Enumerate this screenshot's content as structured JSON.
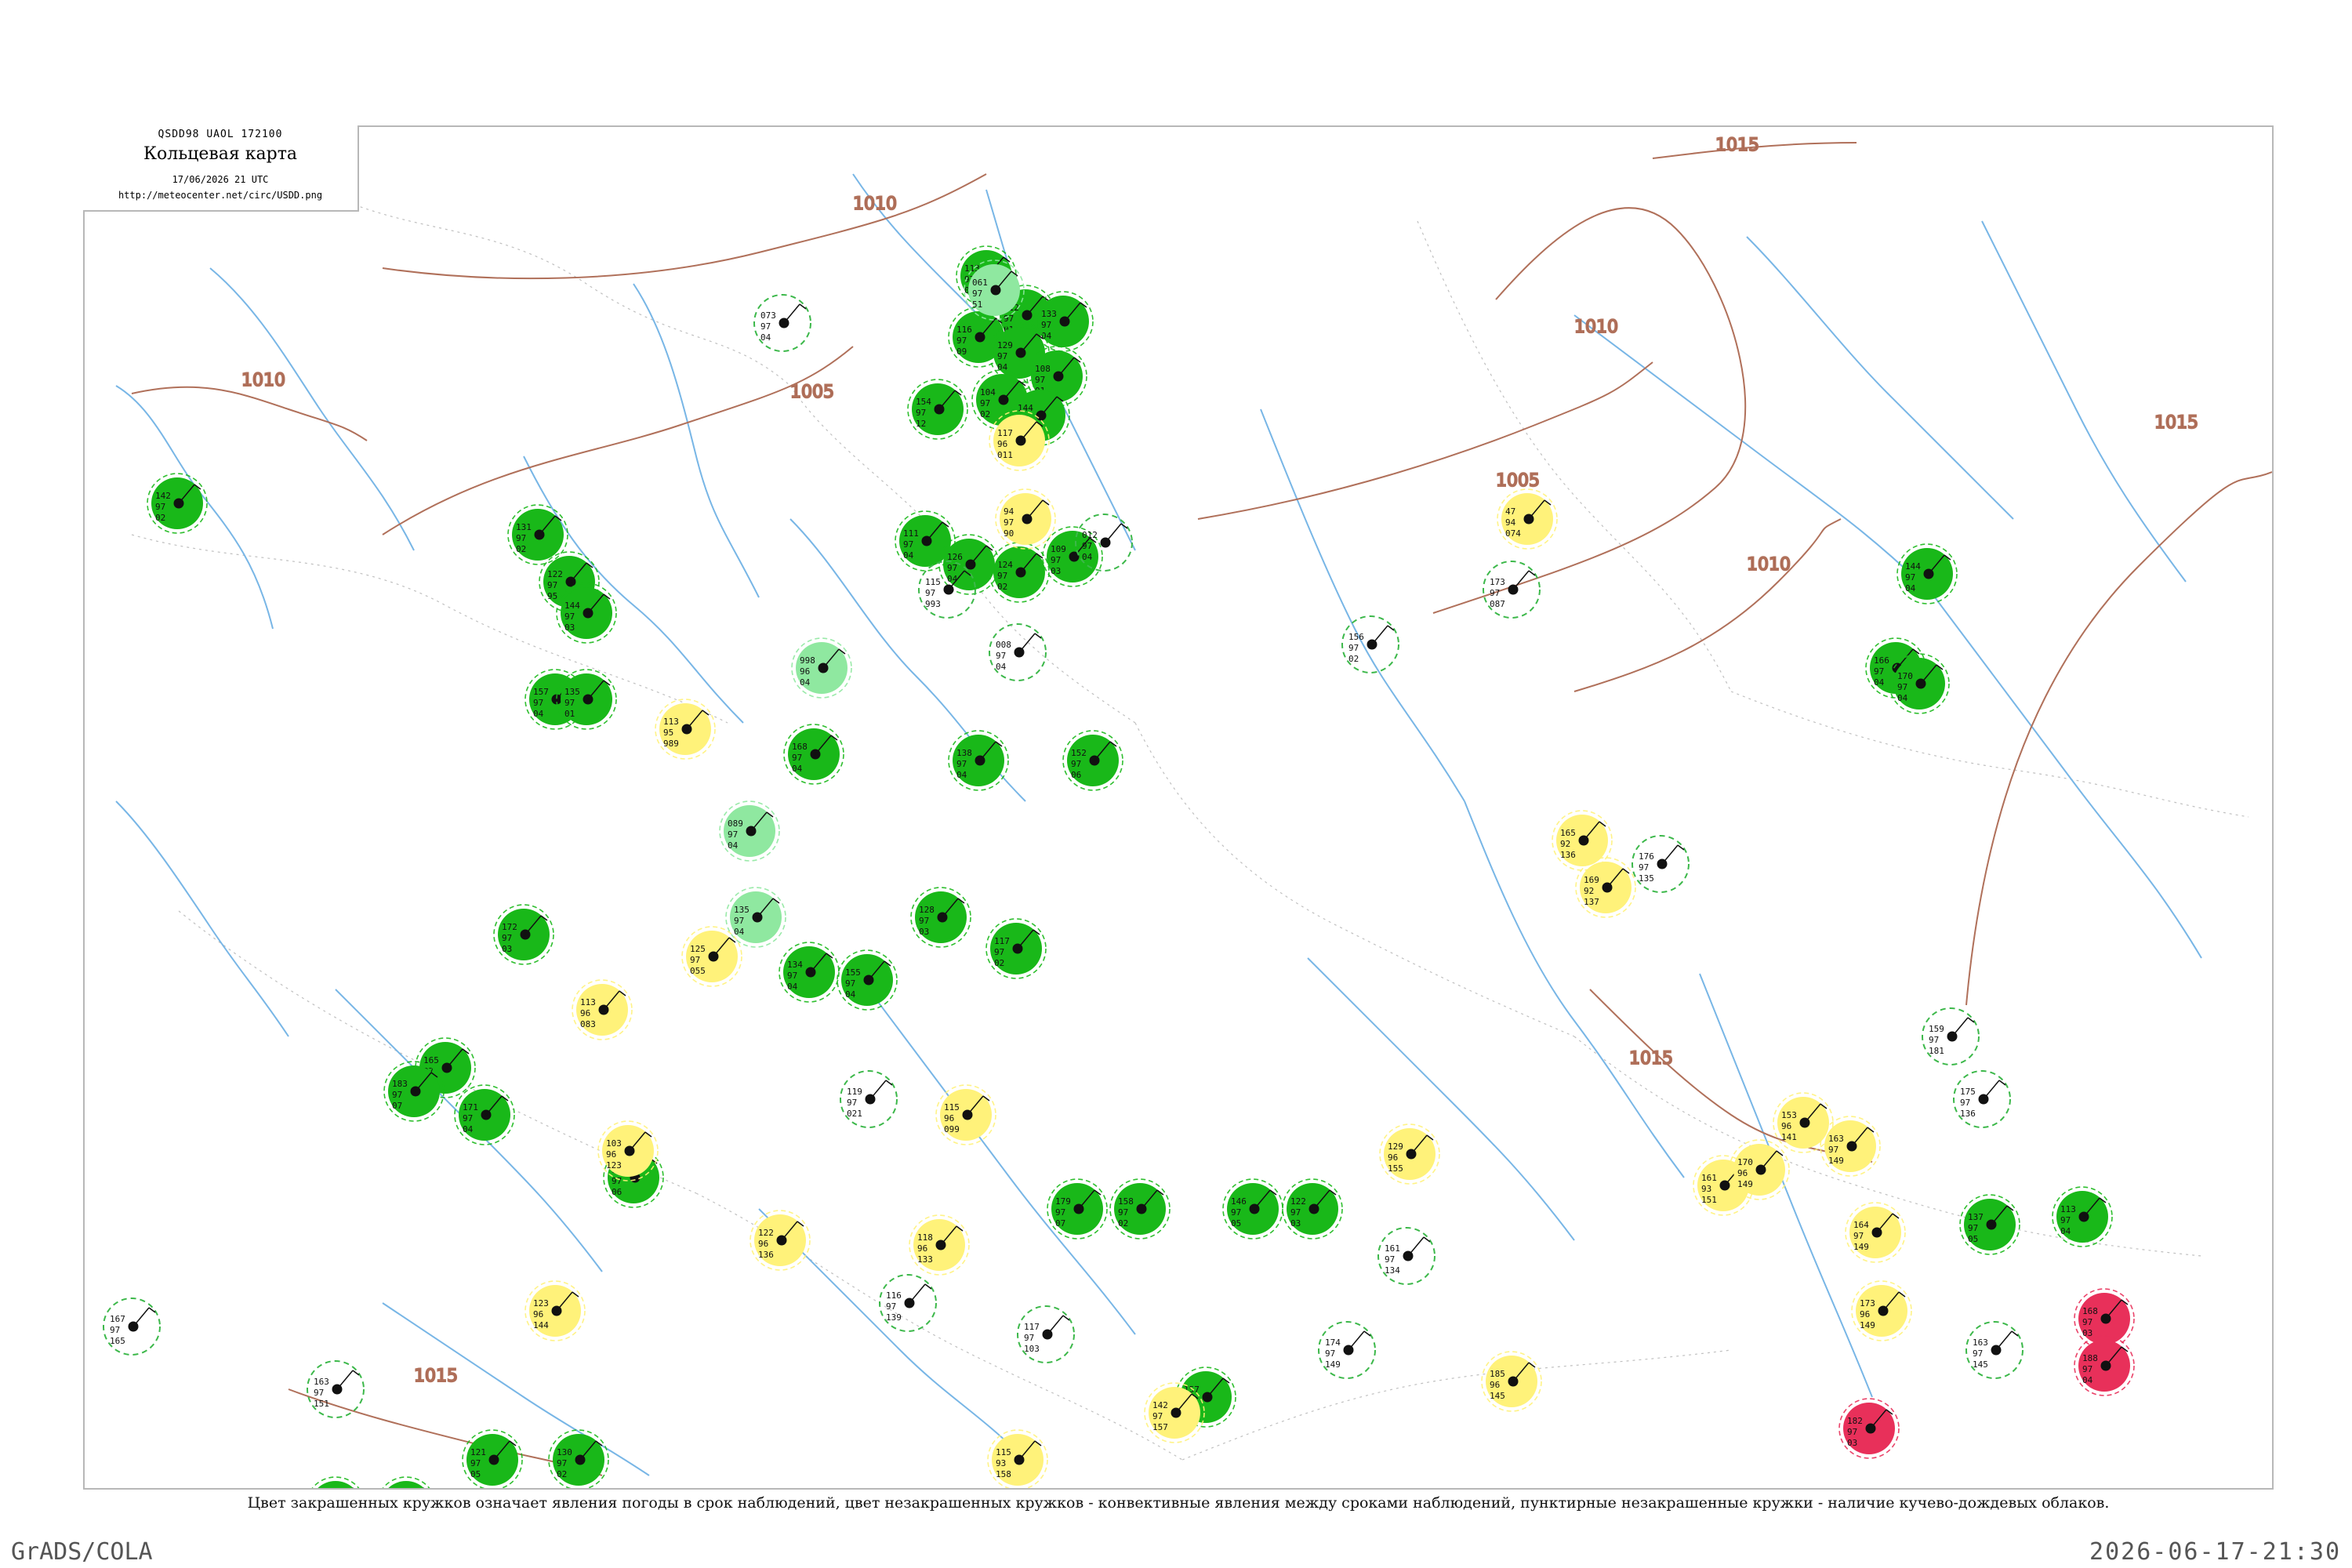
{
  "header": {
    "code": "QSDD98  UAOL  172100",
    "title": "Кольцевая карта",
    "date": "17/06/2026 21 UTC",
    "url": "http://meteocenter.net/circ/USDD.png"
  },
  "caption": "Цвет закрашенных кружков означает явления погоды в срок наблюдений, цвет незакрашенных кружков - конвективные явления между сроками наблюдений, пунктирные незакрашенные кружки - наличие кучево-дождевых облаков.",
  "footer": {
    "left": "GrADS/COLA",
    "right": "2026-06-17-21:30"
  },
  "colors": {
    "rain": "#19b819",
    "shower": "#8fe8a0",
    "fog": "#fff27a",
    "thunder": "#e8305a",
    "isobar": "#b0705a",
    "river": "#78b6e6",
    "border": "#c0c0c0"
  },
  "isobars": [
    {
      "label": "1010"
    },
    {
      "label": "1005"
    },
    {
      "label": "1010"
    },
    {
      "label": "1005"
    },
    {
      "label": "1010"
    },
    {
      "label": "1015"
    },
    {
      "label": "1010"
    },
    {
      "label": "1015"
    },
    {
      "label": "1015"
    },
    {
      "label": "1015"
    }
  ],
  "stations": [
    {
      "kind": "rain",
      "values": [
        "142",
        "97",
        "02"
      ]
    },
    {
      "kind": "rain",
      "values": [
        "131",
        "97",
        "02"
      ]
    },
    {
      "kind": "rain",
      "values": [
        "122",
        "97",
        "95"
      ]
    },
    {
      "kind": "rain",
      "values": [
        "144",
        "97",
        "03"
      ]
    },
    {
      "kind": "rain",
      "values": [
        "113",
        "97",
        "02"
      ]
    },
    {
      "kind": "rain",
      "values": [
        "112",
        "97",
        "01"
      ]
    },
    {
      "kind": "rain",
      "values": [
        "133",
        "97",
        "04"
      ]
    },
    {
      "kind": "rain",
      "values": [
        "116",
        "97",
        "09"
      ]
    },
    {
      "kind": "rain",
      "values": [
        "129",
        "97",
        "04"
      ]
    },
    {
      "kind": "rain",
      "values": [
        "108",
        "97",
        "01"
      ]
    },
    {
      "kind": "rain",
      "values": [
        "104",
        "97",
        "02"
      ]
    },
    {
      "kind": "rain",
      "values": [
        "144",
        "97",
        "03"
      ]
    },
    {
      "kind": "rain",
      "values": [
        "154",
        "97",
        "12"
      ]
    },
    {
      "kind": "rain",
      "values": [
        "109",
        "97",
        "03"
      ]
    },
    {
      "kind": "rain",
      "values": [
        "124",
        "97",
        "02"
      ]
    },
    {
      "kind": "rain",
      "values": [
        "111",
        "97",
        "04"
      ]
    },
    {
      "kind": "rain",
      "values": [
        "126",
        "97",
        "04"
      ]
    },
    {
      "kind": "rain",
      "values": [
        "157",
        "97",
        "04"
      ]
    },
    {
      "kind": "rain",
      "values": [
        "135",
        "97",
        "01"
      ]
    },
    {
      "kind": "rain",
      "values": [
        "152",
        "97",
        "06"
      ]
    },
    {
      "kind": "rain",
      "values": [
        "138",
        "97",
        "04"
      ]
    },
    {
      "kind": "rain",
      "values": [
        "128",
        "97",
        "03"
      ]
    },
    {
      "kind": "rain",
      "values": [
        "117",
        "97",
        "02"
      ]
    },
    {
      "kind": "rain",
      "values": [
        "134",
        "97",
        "04"
      ]
    },
    {
      "kind": "rain",
      "values": [
        "155",
        "97",
        "04"
      ]
    },
    {
      "kind": "rain",
      "values": [
        "168",
        "97",
        "04"
      ]
    },
    {
      "kind": "rain",
      "values": [
        "172",
        "97",
        "03"
      ]
    },
    {
      "kind": "rain",
      "values": [
        "165",
        "97",
        "04"
      ]
    },
    {
      "kind": "rain",
      "values": [
        "183",
        "97",
        "07"
      ]
    },
    {
      "kind": "rain",
      "values": [
        "171",
        "97",
        "04"
      ]
    },
    {
      "kind": "rain",
      "values": [
        "134",
        "97",
        "06"
      ]
    },
    {
      "kind": "rain",
      "values": [
        "179",
        "97",
        "07"
      ]
    },
    {
      "kind": "rain",
      "values": [
        "158",
        "97",
        "02"
      ]
    },
    {
      "kind": "rain",
      "values": [
        "146",
        "97",
        "05"
      ]
    },
    {
      "kind": "rain",
      "values": [
        "122",
        "97",
        "03"
      ]
    },
    {
      "kind": "rain",
      "values": [
        "157",
        "97",
        "04"
      ]
    },
    {
      "kind": "rain",
      "values": [
        "121",
        "97",
        "05"
      ]
    },
    {
      "kind": "rain",
      "values": [
        "130",
        "97",
        "02"
      ]
    },
    {
      "kind": "rain",
      "values": [
        "127",
        "97",
        "03"
      ]
    },
    {
      "kind": "rain",
      "values": [
        "134",
        "97",
        "03"
      ]
    },
    {
      "kind": "rain",
      "values": [
        "166",
        "97",
        "04"
      ]
    },
    {
      "kind": "rain",
      "values": [
        "170",
        "97",
        "04"
      ]
    },
    {
      "kind": "rain",
      "values": [
        "144",
        "97",
        "04"
      ]
    },
    {
      "kind": "rain",
      "values": [
        "137",
        "97",
        "05"
      ]
    },
    {
      "kind": "rain",
      "values": [
        "113",
        "97",
        "04"
      ]
    },
    {
      "kind": "shower",
      "values": [
        "061",
        "97",
        "51"
      ]
    },
    {
      "kind": "shower",
      "values": [
        "998",
        "96",
        "04"
      ]
    },
    {
      "kind": "shower",
      "values": [
        "089",
        "97",
        "04"
      ]
    },
    {
      "kind": "shower",
      "values": [
        "135",
        "97",
        "04"
      ]
    },
    {
      "kind": "fog",
      "values": [
        "117",
        "96",
        "011"
      ]
    },
    {
      "kind": "fog",
      "values": [
        "94",
        "97",
        "90"
      ]
    },
    {
      "kind": "fog",
      "values": [
        "113",
        "95",
        "989"
      ]
    },
    {
      "kind": "fog",
      "values": [
        "125",
        "97",
        "055"
      ]
    },
    {
      "kind": "fog",
      "values": [
        "113",
        "96",
        "083"
      ]
    },
    {
      "kind": "fog",
      "values": [
        "115",
        "96",
        "099"
      ]
    },
    {
      "kind": "fog",
      "values": [
        "103",
        "96",
        "123"
      ]
    },
    {
      "kind": "fog",
      "values": [
        "122",
        "96",
        "136"
      ]
    },
    {
      "kind": "fog",
      "values": [
        "118",
        "96",
        "133"
      ]
    },
    {
      "kind": "fog",
      "values": [
        "123",
        "96",
        "144"
      ]
    },
    {
      "kind": "fog",
      "values": [
        "115",
        "93",
        "158"
      ]
    },
    {
      "kind": "fog",
      "values": [
        "142",
        "97",
        "157"
      ]
    },
    {
      "kind": "fog",
      "values": [
        "47",
        "94",
        "074"
      ]
    },
    {
      "kind": "fog",
      "values": [
        "165",
        "92",
        "136"
      ]
    },
    {
      "kind": "fog",
      "values": [
        "169",
        "92",
        "137"
      ]
    },
    {
      "kind": "fog",
      "values": [
        "129",
        "96",
        "155"
      ]
    },
    {
      "kind": "fog",
      "values": [
        "161",
        "93",
        "151"
      ]
    },
    {
      "kind": "fog",
      "values": [
        "170",
        "96",
        "149"
      ]
    },
    {
      "kind": "fog",
      "values": [
        "153",
        "96",
        "141"
      ]
    },
    {
      "kind": "fog",
      "values": [
        "163",
        "97",
        "149"
      ]
    },
    {
      "kind": "fog",
      "values": [
        "164",
        "97",
        "149"
      ]
    },
    {
      "kind": "fog",
      "values": [
        "173",
        "96",
        "149"
      ]
    },
    {
      "kind": "fog",
      "values": [
        "185",
        "96",
        "145"
      ]
    },
    {
      "kind": "thunder",
      "values": [
        "168",
        "97",
        "03"
      ]
    },
    {
      "kind": "thunder",
      "values": [
        "188",
        "97",
        "04"
      ]
    },
    {
      "kind": "thunder",
      "values": [
        "182",
        "97",
        "03"
      ]
    },
    {
      "kind": "outline",
      "values": [
        "073",
        "97",
        "04"
      ]
    },
    {
      "kind": "outline",
      "values": [
        "012",
        "97",
        "04"
      ]
    },
    {
      "kind": "outline",
      "values": [
        "115",
        "97",
        "993"
      ]
    },
    {
      "kind": "outline",
      "values": [
        "008",
        "97",
        "04"
      ]
    },
    {
      "kind": "outline",
      "values": [
        "156",
        "97",
        "02"
      ]
    },
    {
      "kind": "outline",
      "values": [
        "117",
        "97",
        "103"
      ]
    },
    {
      "kind": "outline",
      "values": [
        "116",
        "97",
        "139"
      ]
    },
    {
      "kind": "outline",
      "values": [
        "176",
        "97",
        "135"
      ]
    },
    {
      "kind": "outline",
      "values": [
        "175",
        "97",
        "136"
      ]
    },
    {
      "kind": "outline",
      "values": [
        "173",
        "97",
        "087"
      ]
    },
    {
      "kind": "outline",
      "values": [
        "163",
        "97",
        "145"
      ]
    },
    {
      "kind": "outline",
      "values": [
        "174",
        "97",
        "149"
      ]
    },
    {
      "kind": "outline",
      "values": [
        "167",
        "97",
        "165"
      ]
    },
    {
      "kind": "outline",
      "values": [
        "163",
        "97",
        "151"
      ]
    },
    {
      "kind": "outline",
      "values": [
        "159",
        "97",
        "181"
      ]
    },
    {
      "kind": "outline",
      "values": [
        "161",
        "97",
        "134"
      ]
    },
    {
      "kind": "outline",
      "values": [
        "119",
        "97",
        "021"
      ]
    }
  ]
}
